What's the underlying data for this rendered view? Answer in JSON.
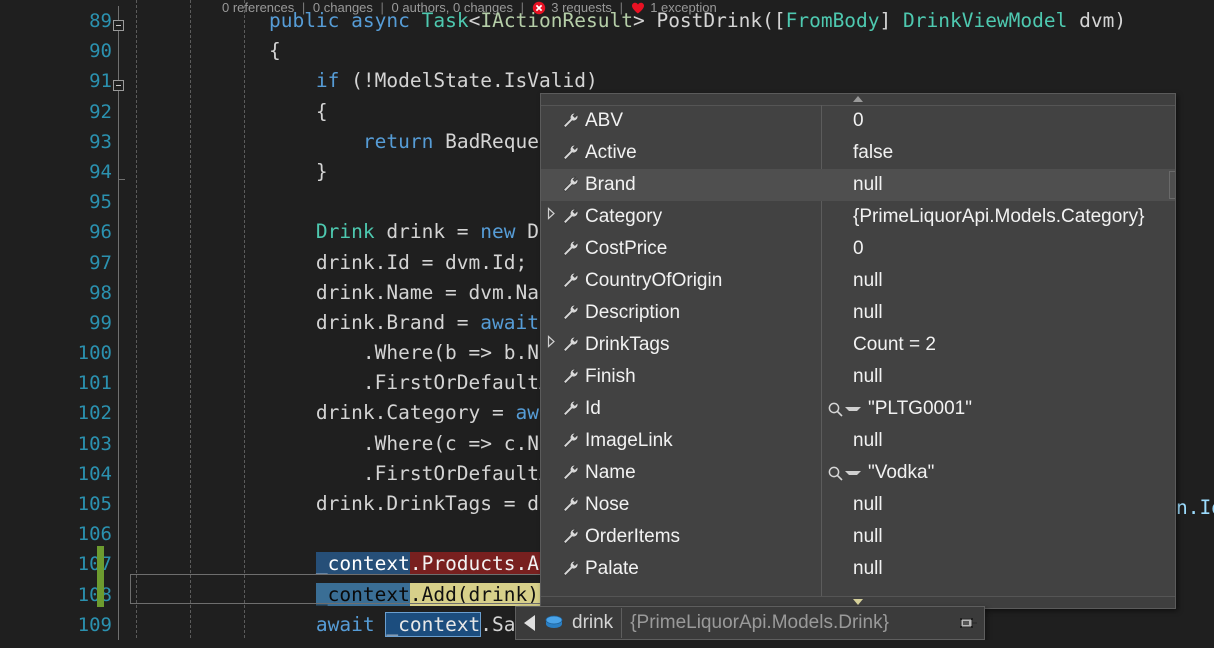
{
  "codelens": {
    "references": "0 references",
    "changes": "0 changes",
    "authors": "0 authors, 0 changes",
    "requests": "3 requests",
    "exceptions": "1 exception",
    "separator": "|",
    "error_icon": "error-circle-icon",
    "exception_icon": "exception-heart-icon"
  },
  "editor": {
    "line_numbers": [
      "89",
      "90",
      "91",
      "92",
      "93",
      "94",
      "95",
      "96",
      "97",
      "98",
      "99",
      "100",
      "101",
      "102",
      "103",
      "104",
      "105",
      "106",
      "107",
      "108",
      "109"
    ],
    "lines": [
      {
        "n": "89",
        "segments": [
          {
            "t": "    ",
            "c": "plain"
          },
          {
            "t": "public",
            "c": "kw"
          },
          {
            "t": " ",
            "c": "plain"
          },
          {
            "t": "async",
            "c": "kw"
          },
          {
            "t": " ",
            "c": "plain"
          },
          {
            "t": "Task",
            "c": "type"
          },
          {
            "t": "<",
            "c": "plain"
          },
          {
            "t": "IActionResult",
            "c": "gen"
          },
          {
            "t": "> ",
            "c": "plain"
          },
          {
            "t": "PostDrink",
            "c": "plain"
          },
          {
            "t": "([",
            "c": "plain"
          },
          {
            "t": "FromBody",
            "c": "type"
          },
          {
            "t": "] ",
            "c": "plain"
          },
          {
            "t": "DrinkViewModel",
            "c": "type"
          },
          {
            "t": " dvm)",
            "c": "plain"
          }
        ]
      },
      {
        "n": "90",
        "segments": [
          {
            "t": "    {",
            "c": "plain"
          }
        ]
      },
      {
        "n": "91",
        "segments": [
          {
            "t": "        ",
            "c": "plain"
          },
          {
            "t": "if",
            "c": "kw"
          },
          {
            "t": " (!ModelState.IsValid)",
            "c": "plain"
          }
        ]
      },
      {
        "n": "92",
        "segments": [
          {
            "t": "        {",
            "c": "plain"
          }
        ]
      },
      {
        "n": "93",
        "segments": [
          {
            "t": "            ",
            "c": "plain"
          },
          {
            "t": "return",
            "c": "kw"
          },
          {
            "t": " BadReques",
            "c": "plain"
          }
        ]
      },
      {
        "n": "94",
        "segments": [
          {
            "t": "        }",
            "c": "plain"
          }
        ]
      },
      {
        "n": "95",
        "segments": [
          {
            "t": "",
            "c": "plain"
          }
        ]
      },
      {
        "n": "96",
        "segments": [
          {
            "t": "        ",
            "c": "plain"
          },
          {
            "t": "Drink",
            "c": "type"
          },
          {
            "t": " drink = ",
            "c": "plain"
          },
          {
            "t": "new",
            "c": "kw"
          },
          {
            "t": " D",
            "c": "plain"
          }
        ]
      },
      {
        "n": "97",
        "segments": [
          {
            "t": "        drink.Id = dvm.Id;",
            "c": "plain"
          }
        ]
      },
      {
        "n": "98",
        "segments": [
          {
            "t": "        drink.Name = dvm.Nam",
            "c": "plain"
          }
        ]
      },
      {
        "n": "99",
        "segments": [
          {
            "t": "        drink.Brand = ",
            "c": "plain"
          },
          {
            "t": "await",
            "c": "kw"
          },
          {
            "t": " ",
            "c": "plain"
          }
        ]
      },
      {
        "n": "100",
        "segments": [
          {
            "t": "            .Where(b => b.Na",
            "c": "plain"
          }
        ]
      },
      {
        "n": "101",
        "segments": [
          {
            "t": "            .FirstOrDefaultA",
            "c": "plain"
          }
        ]
      },
      {
        "n": "102",
        "segments": [
          {
            "t": "        drink.Category = ",
            "c": "plain"
          },
          {
            "t": "awa",
            "c": "kw"
          }
        ]
      },
      {
        "n": "103",
        "segments": [
          {
            "t": "            .Where(c => c.Na",
            "c": "plain"
          }
        ]
      },
      {
        "n": "104",
        "segments": [
          {
            "t": "            .FirstOrDefaultA",
            "c": "plain"
          }
        ]
      },
      {
        "n": "105",
        "segments": [
          {
            "t": "        drink.DrinkTags = dv",
            "c": "plain"
          }
        ]
      },
      {
        "n": "106",
        "segments": [
          {
            "t": "",
            "c": "plain"
          }
        ]
      },
      {
        "n": "107",
        "segments": [
          {
            "t": "        ",
            "c": "plain"
          },
          {
            "t": "_context",
            "c": "sel-blue"
          },
          {
            "t": ".Products.Ad",
            "c": "sel-red"
          }
        ]
      },
      {
        "n": "108",
        "segments": [
          {
            "t": "        ",
            "c": "plain"
          },
          {
            "t": "_context",
            "c": "sel-steel"
          },
          {
            "t": ".Add(drink);",
            "c": "sel-yellow"
          }
        ]
      },
      {
        "n": "109",
        "segments": [
          {
            "t": "        ",
            "c": "plain"
          },
          {
            "t": "await",
            "c": "kw"
          },
          {
            "t": " ",
            "c": "plain"
          },
          {
            "t": "_context",
            "c": "ref-hl"
          },
          {
            "t": ".Sa",
            "c": "plain"
          }
        ]
      }
    ],
    "right_fragment": "n.Id",
    "fold_markers": [
      "89",
      "91"
    ],
    "change_bar_lines": [
      "107",
      "108"
    ]
  },
  "datatip": {
    "scroll_up_icon": "scroll-up-arrow-icon",
    "scroll_down_icon": "scroll-down-arrow-icon",
    "pin_icon": "pin-to-source-icon",
    "rows": [
      {
        "name": "ABV",
        "value": "0",
        "expandable": false,
        "magnifier": false,
        "hover": false
      },
      {
        "name": "Active",
        "value": "false",
        "expandable": false,
        "magnifier": false,
        "hover": false
      },
      {
        "name": "Brand",
        "value": "null",
        "expandable": false,
        "magnifier": false,
        "hover": true
      },
      {
        "name": "Category",
        "value": "{PrimeLiquorApi.Models.Category}",
        "expandable": true,
        "magnifier": false,
        "hover": false
      },
      {
        "name": "CostPrice",
        "value": "0",
        "expandable": false,
        "magnifier": false,
        "hover": false
      },
      {
        "name": "CountryOfOrigin",
        "value": "null",
        "expandable": false,
        "magnifier": false,
        "hover": false
      },
      {
        "name": "Description",
        "value": "null",
        "expandable": false,
        "magnifier": false,
        "hover": false
      },
      {
        "name": "DrinkTags",
        "value": "Count = 2",
        "expandable": true,
        "magnifier": false,
        "hover": false
      },
      {
        "name": "Finish",
        "value": "null",
        "expandable": false,
        "magnifier": false,
        "hover": false
      },
      {
        "name": "Id",
        "value": "\"PLTG0001\"",
        "expandable": false,
        "magnifier": true,
        "hover": false
      },
      {
        "name": "ImageLink",
        "value": "null",
        "expandable": false,
        "magnifier": false,
        "hover": false
      },
      {
        "name": "Name",
        "value": "\"Vodka\"",
        "expandable": false,
        "magnifier": true,
        "hover": false
      },
      {
        "name": "Nose",
        "value": "null",
        "expandable": false,
        "magnifier": false,
        "hover": false
      },
      {
        "name": "OrderItems",
        "value": "null",
        "expandable": false,
        "magnifier": false,
        "hover": false
      },
      {
        "name": "Palate",
        "value": "null",
        "expandable": false,
        "magnifier": false,
        "hover": false
      }
    ]
  },
  "expression_bar": {
    "collapse_icon": "collapse-left-triangle-icon",
    "object_icon": "object-cube-icon",
    "name": "drink",
    "type": "{PrimeLiquorApi.Models.Drink}",
    "pin_icon": "pin-to-source-icon"
  },
  "colors": {
    "editor_bg": "#1f1f1f",
    "line_number": "#2b91af",
    "keyword": "#569cd6",
    "type": "#4ec9b0",
    "generic": "#b5cea8",
    "selection_blue": "#264f78",
    "error_red": "#78201f",
    "current_statement_yellow": "#d7d08a",
    "steel_blue": "#3a6e95",
    "change_bar_green": "#6d9b2f",
    "datatip_bg": "#424242",
    "datatip_hover": "#4f4f4f"
  }
}
